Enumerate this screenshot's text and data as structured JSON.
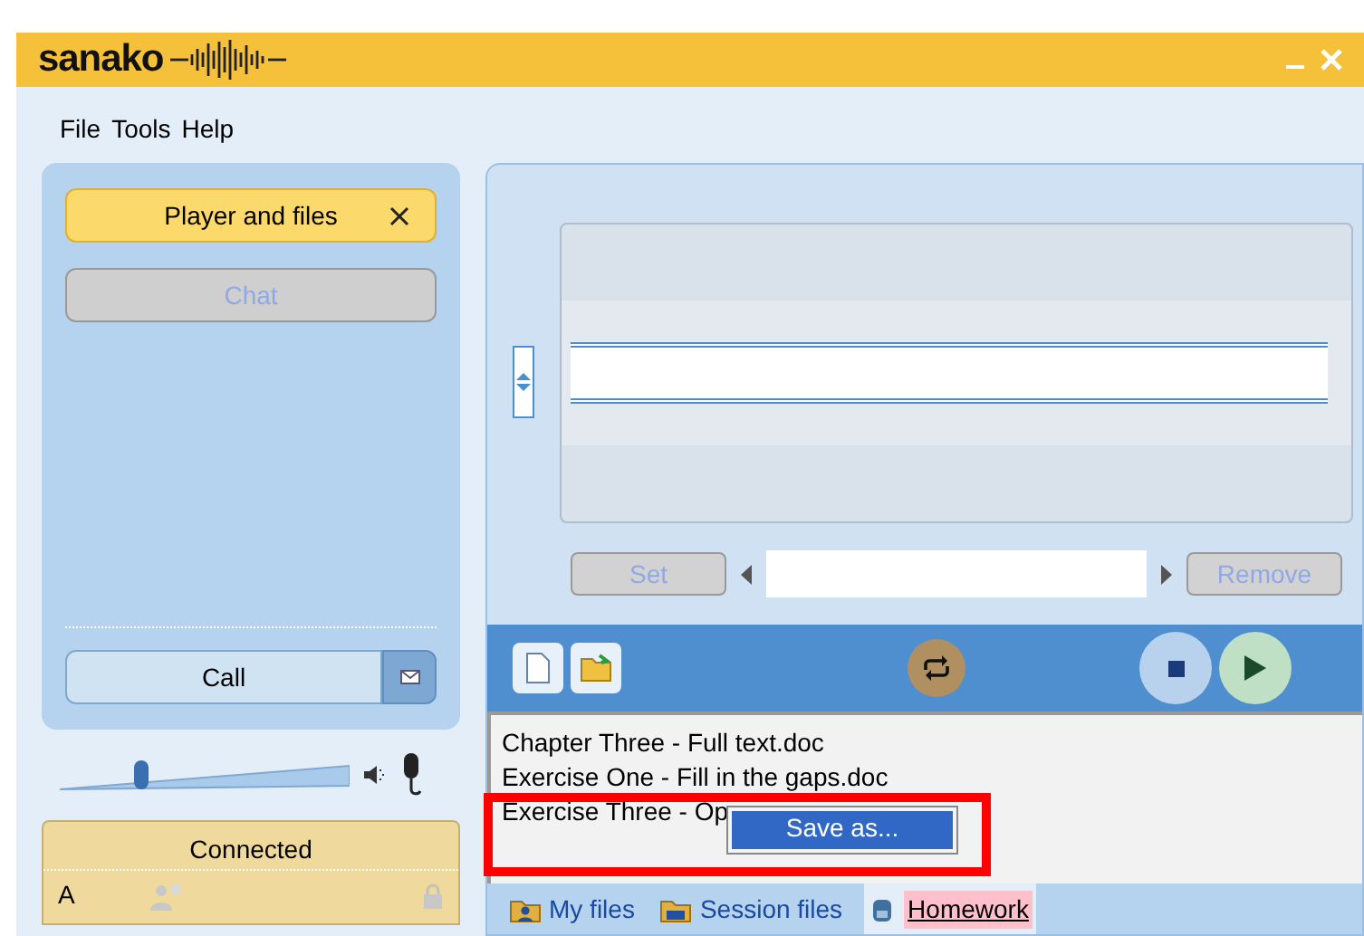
{
  "app": {
    "logo": "sanako"
  },
  "menu": [
    "File",
    "Tools",
    "Help"
  ],
  "sidebar": {
    "buttons": [
      {
        "label": "Player and files",
        "selected": true,
        "disabled": false,
        "closable": true
      },
      {
        "label": "Chat",
        "selected": false,
        "disabled": true,
        "closable": false
      }
    ],
    "call_button": "Call",
    "volume": {
      "level": 0.27
    },
    "status": {
      "text": "Connected",
      "letter": "A"
    }
  },
  "editor": {
    "set_button": {
      "label": "Set",
      "disabled": true
    },
    "remove_button": {
      "label": "Remove",
      "disabled": true
    }
  },
  "files": [
    "Chapter Three - Full text.doc",
    "Exercise One - Fill in the gaps.doc",
    "Exercise Three - Op"
  ],
  "context_menu": {
    "items": [
      {
        "label": "Save as...",
        "selected": true
      }
    ]
  },
  "tabs": [
    {
      "label": "My files",
      "selected": false,
      "kind": "people"
    },
    {
      "label": "Session files",
      "selected": false,
      "kind": "session"
    },
    {
      "label": "Homework",
      "selected": true,
      "kind": "homework"
    }
  ]
}
